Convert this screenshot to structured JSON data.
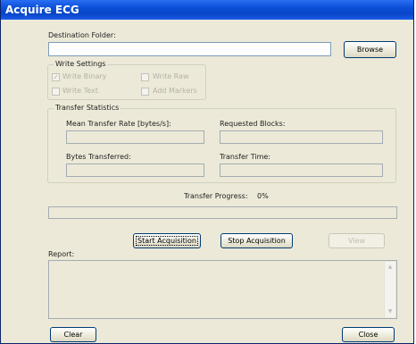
{
  "window": {
    "title": "Acquire ECG"
  },
  "destination": {
    "label": "Destination Folder:",
    "value": "",
    "browse_label": "Browse"
  },
  "write_settings": {
    "title": "Write Settings",
    "write_binary": "Write Binary",
    "write_raw": "Write Raw",
    "write_text": "Write Text",
    "add_markers": "Add Markers",
    "write_binary_checked": true,
    "write_raw_checked": false,
    "write_text_checked": false,
    "add_markers_checked": false
  },
  "transfer_stats": {
    "title": "Transfer Statistics",
    "mean_rate_label": "Mean Transfer Rate [bytes/s]:",
    "requested_blocks_label": "Requested Blocks:",
    "bytes_transferred_label": "Bytes Transferred:",
    "transfer_time_label": "Transfer Time:"
  },
  "progress": {
    "label": "Transfer Progress:",
    "value": "0%",
    "fraction": 0
  },
  "buttons": {
    "start": "Start Acquisition",
    "stop": "Stop Acquisition",
    "view": "View",
    "clear": "Clear",
    "close": "Close"
  },
  "report": {
    "label": "Report:",
    "value": ""
  },
  "icons": {
    "checkmark": "check-icon",
    "scroll_up": "scroll-up-arrow-icon",
    "scroll_down": "scroll-down-arrow-icon"
  },
  "colors": {
    "titlebar": "#0b4fd8",
    "window_bg": "#ece9d8",
    "disabled_text": "#b4b2a4"
  }
}
